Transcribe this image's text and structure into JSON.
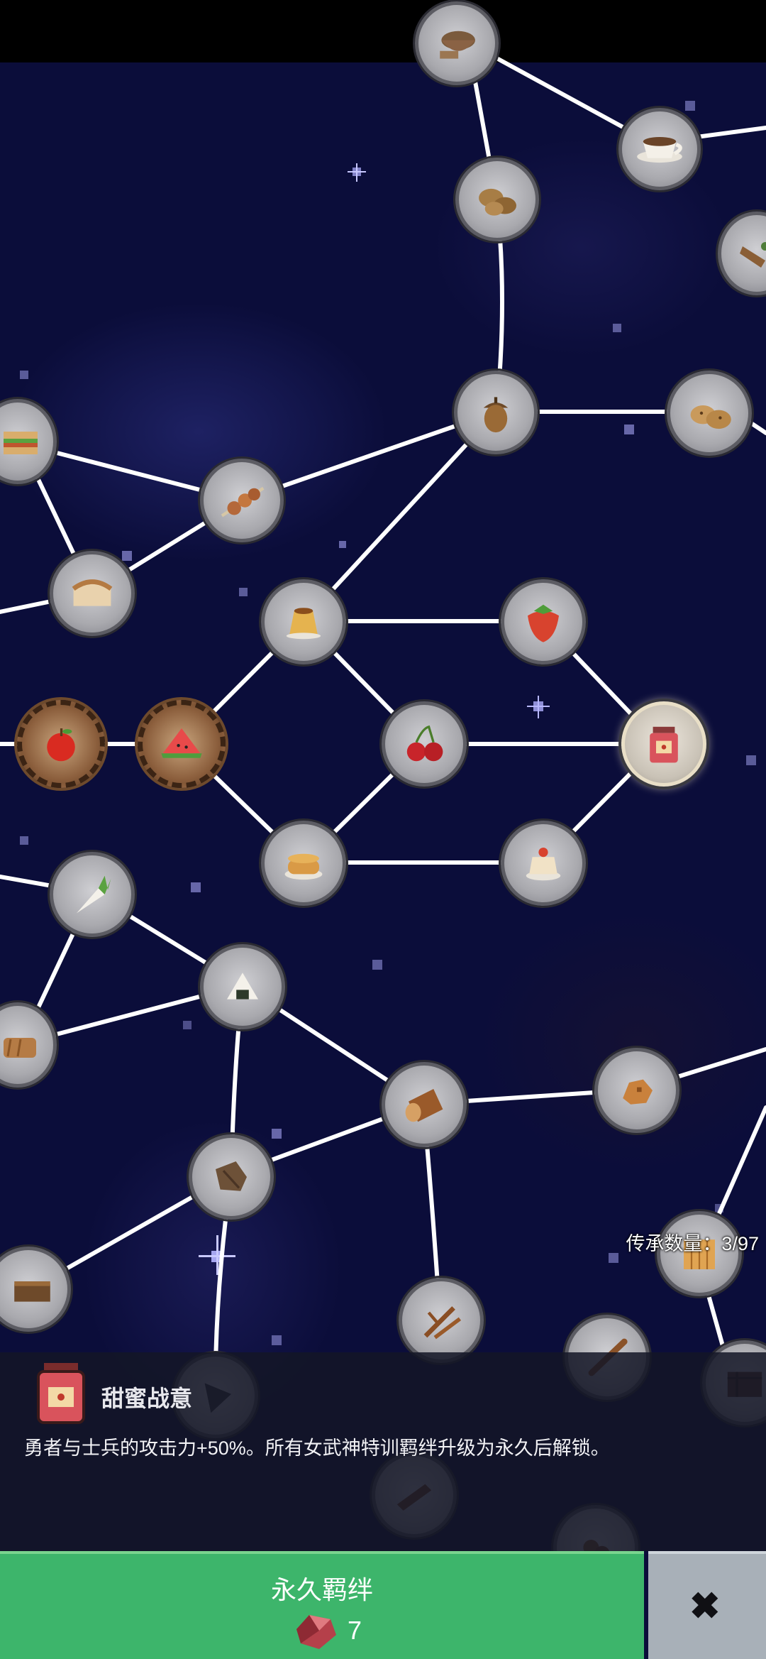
{
  "tree": {
    "counter_label": "传承数量：3/97",
    "nodes": [
      {
        "id": "spice-bowl",
        "icon": "spice-bowl-icon",
        "state": "plain"
      },
      {
        "id": "coffee-cup",
        "icon": "coffee-cup-icon",
        "state": "plain"
      },
      {
        "id": "potatoes",
        "icon": "potatoes-icon",
        "state": "plain"
      },
      {
        "id": "ginseng",
        "icon": "ginseng-icon",
        "state": "plain"
      },
      {
        "id": "acorn",
        "icon": "acorn-icon",
        "state": "plain"
      },
      {
        "id": "cookies",
        "icon": "cookies-icon",
        "state": "plain"
      },
      {
        "id": "sandwich",
        "icon": "sandwich-icon",
        "state": "plain"
      },
      {
        "id": "skewer",
        "icon": "skewer-icon",
        "state": "plain"
      },
      {
        "id": "bread",
        "icon": "bread-icon",
        "state": "plain"
      },
      {
        "id": "pudding",
        "icon": "pudding-icon",
        "state": "plain"
      },
      {
        "id": "strawberry",
        "icon": "strawberry-icon",
        "state": "plain"
      },
      {
        "id": "apple",
        "icon": "apple-icon",
        "state": "bronze"
      },
      {
        "id": "watermelon",
        "icon": "watermelon-icon",
        "state": "bronze"
      },
      {
        "id": "cherry",
        "icon": "cherry-icon",
        "state": "plain"
      },
      {
        "id": "jam-jar",
        "icon": "jam-jar-icon",
        "state": "selected"
      },
      {
        "id": "pancakes",
        "icon": "pancakes-icon",
        "state": "plain"
      },
      {
        "id": "cream-cake",
        "icon": "cream-cake-icon",
        "state": "plain"
      },
      {
        "id": "radish",
        "icon": "radish-icon",
        "state": "plain"
      },
      {
        "id": "onigiri",
        "icon": "onigiri-icon",
        "state": "plain"
      },
      {
        "id": "bread-loaf",
        "icon": "bread-loaf-icon",
        "state": "plain"
      },
      {
        "id": "log",
        "icon": "log-icon",
        "state": "plain"
      },
      {
        "id": "ore",
        "icon": "ore-icon",
        "state": "plain"
      },
      {
        "id": "bark",
        "icon": "bark-icon",
        "state": "plain"
      },
      {
        "id": "planks",
        "icon": "planks-icon",
        "state": "plain"
      },
      {
        "id": "brick",
        "icon": "brick-icon",
        "state": "plain"
      },
      {
        "id": "twigs",
        "icon": "twigs-icon",
        "state": "plain"
      },
      {
        "id": "stick",
        "icon": "stick-icon",
        "state": "plain"
      },
      {
        "id": "crate",
        "icon": "crate-icon",
        "state": "plain"
      },
      {
        "id": "arrowhead",
        "icon": "arrowhead-icon",
        "state": "plain"
      },
      {
        "id": "board",
        "icon": "board-icon",
        "state": "plain"
      },
      {
        "id": "nuts",
        "icon": "nuts-icon",
        "state": "plain"
      }
    ]
  },
  "detail": {
    "icon": "jam-jar-icon",
    "name": "甜蜜战意",
    "description": "勇者与士兵的攻击力+50%。所有女武神特训羁绊升级为永久后解锁。"
  },
  "actions": {
    "buy_label": "永久羁绊",
    "cost_icon": "ruby-gem-icon",
    "cost_value": "7",
    "close_icon": "close-x-icon"
  },
  "colors": {
    "buy_button": "#3db56b",
    "close_button": "#a8b0b8",
    "sky": "#0b0d3a",
    "links": "#ffffff"
  }
}
